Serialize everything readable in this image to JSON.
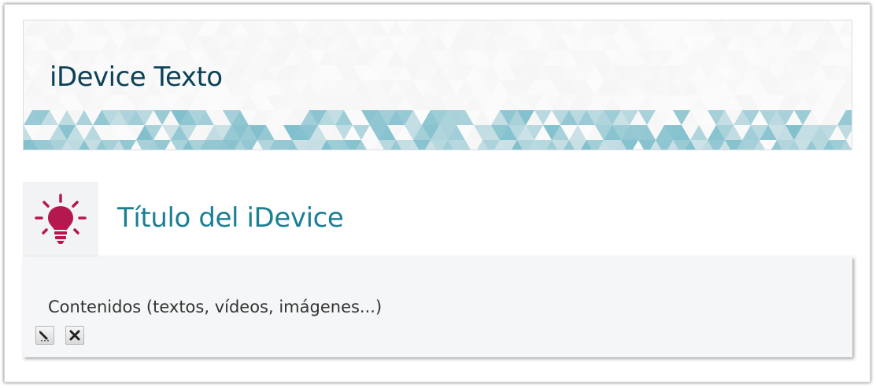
{
  "page": {
    "title": "iDevice Texto"
  },
  "idevice": {
    "title": "Título del iDevice",
    "icon": "lightbulb-icon",
    "content": "Contenidos (textos, vídeos, imágenes...)"
  },
  "toolbar": {
    "edit_icon": "edit-pencil-icon",
    "delete_icon": "delete-x-icon"
  },
  "colors": {
    "page_title": "#0c4157",
    "idevice_title": "#1b7f94",
    "icon_accent": "#b5174f",
    "header_pattern": "#5aaec0"
  }
}
